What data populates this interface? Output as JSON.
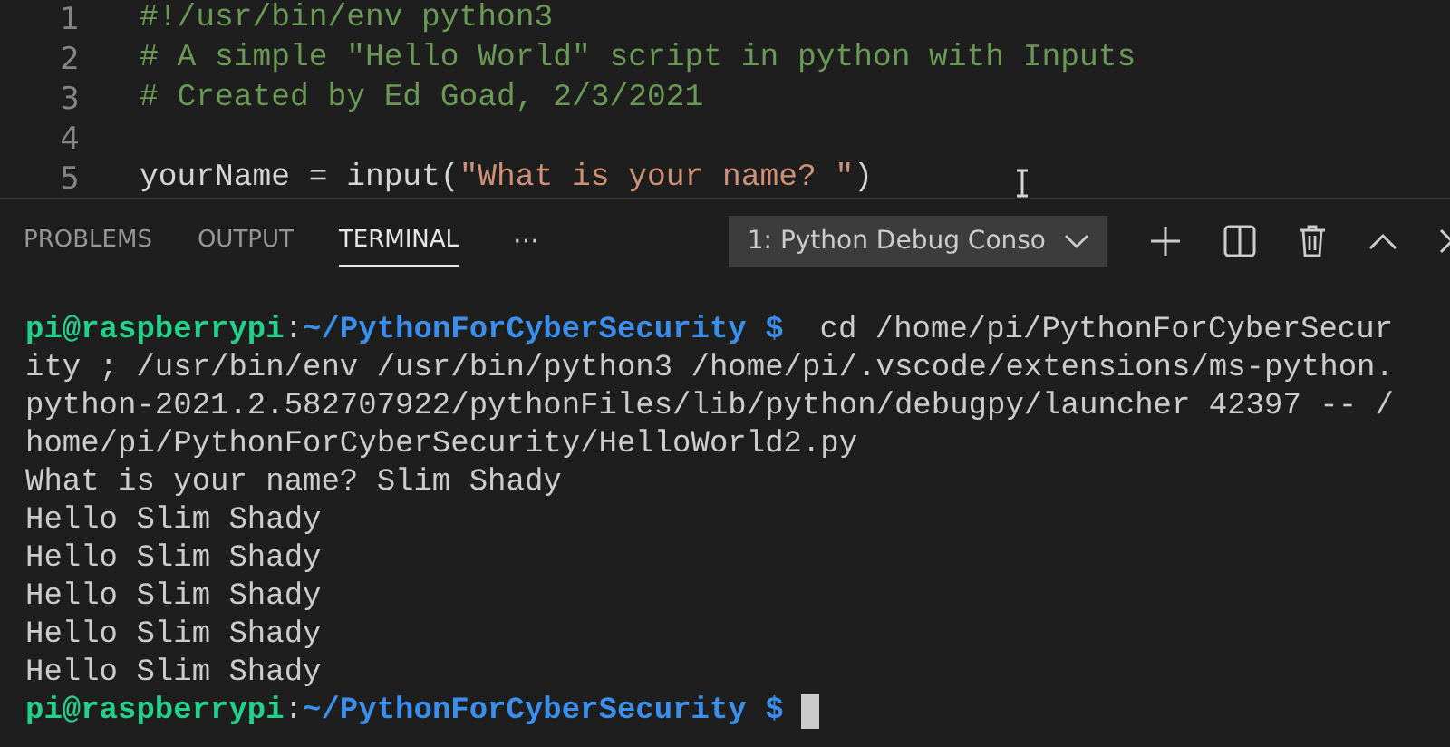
{
  "editor": {
    "lines": [
      {
        "number": "1",
        "tokens": [
          {
            "kind": "comment",
            "text": "#!/usr/bin/env python3"
          }
        ]
      },
      {
        "number": "2",
        "tokens": [
          {
            "kind": "comment",
            "text": "# A simple \"Hello World\" script in python with Inputs"
          }
        ]
      },
      {
        "number": "3",
        "tokens": [
          {
            "kind": "comment",
            "text": "# Created by Ed Goad, 2/3/2021"
          }
        ]
      },
      {
        "number": "4"
      },
      {
        "number": "5",
        "tokens": [
          {
            "kind": "plain",
            "text": "yourName = input("
          },
          {
            "kind": "string",
            "text": "\"What is your name? \""
          },
          {
            "kind": "plain",
            "text": ")"
          }
        ]
      }
    ]
  },
  "panel": {
    "tabs": [
      {
        "label": "PROBLEMS",
        "selected": false
      },
      {
        "label": "OUTPUT",
        "selected": false
      },
      {
        "label": "TERMINAL",
        "selected": true
      }
    ],
    "more": "···",
    "terminal_select": "1: Python Debug Conso"
  },
  "terminal": {
    "lines": [
      {
        "kind": "prompt",
        "user": "pi@raspberrypi",
        "separator": ":",
        "path": "~/PythonForCyberSecurity $",
        "command": "cd /home/pi/PythonForCyberSecur"
      },
      {
        "kind": "output",
        "text": "ity ; /usr/bin/env /usr/bin/python3 /home/pi/.vscode/extensions/ms-python."
      },
      {
        "kind": "output",
        "text": "python-2021.2.582707922/pythonFiles/lib/python/debugpy/launcher 42397 -- /"
      },
      {
        "kind": "output",
        "text": "home/pi/PythonForCyberSecurity/HelloWorld2.py"
      },
      {
        "kind": "output",
        "text": "What is your name? Slim Shady"
      },
      {
        "kind": "output",
        "text": "Hello Slim Shady"
      },
      {
        "kind": "output",
        "text": "Hello Slim Shady"
      },
      {
        "kind": "output",
        "text": "Hello Slim Shady"
      },
      {
        "kind": "output",
        "text": "Hello Slim Shady"
      },
      {
        "kind": "output",
        "text": "Hello Slim Shady"
      },
      {
        "kind": "prompt",
        "user": "pi@raspberrypi",
        "separator": ":",
        "path": "~/PythonForCyberSecurity $",
        "cursor": true
      }
    ]
  }
}
